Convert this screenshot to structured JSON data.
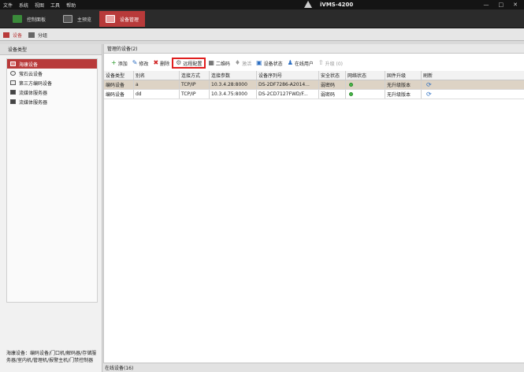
{
  "menu": [
    "文件",
    "系统",
    "视图",
    "工具",
    "帮助"
  ],
  "app_title": "iVMS-4200",
  "window_controls": [
    "—",
    "□",
    "✕"
  ],
  "top_tabs": [
    {
      "label": "控制面板"
    },
    {
      "label": "主预览"
    },
    {
      "label": "设备管理",
      "active": true
    }
  ],
  "sub_tabs": [
    {
      "label": "设备"
    },
    {
      "label": "分组"
    }
  ],
  "left_panel": {
    "header": "设备类型",
    "types": [
      {
        "label": "海康设备",
        "selected": true
      },
      {
        "label": "萤石云设备"
      },
      {
        "label": "第三方编码设备"
      },
      {
        "label": "流媒体服务器"
      },
      {
        "label": "流媒体服务器"
      }
    ],
    "note": "海康设备：编码设备/门口机/解码器/存储服务器/室内机/管理机/报警主机/门禁控制器"
  },
  "right_panel": {
    "header": "管理的设备(2)",
    "toolbar": [
      {
        "icon": "+",
        "label": "添加"
      },
      {
        "icon": "✎",
        "label": "修改"
      },
      {
        "icon": "✖",
        "label": "删除"
      },
      {
        "icon": "⚙",
        "label": "远程配置",
        "highlight": true
      },
      {
        "icon": "▦",
        "label": "二维码"
      },
      {
        "icon": "♦",
        "label": "激活",
        "disabled": true
      },
      {
        "icon": "▣",
        "label": "设备状态"
      },
      {
        "icon": "♟",
        "label": "在线用户"
      },
      {
        "icon": "⇧",
        "label": "升级 (0)",
        "disabled": true
      }
    ],
    "columns": [
      "设备类型",
      "别名",
      "连接方式",
      "连接参数",
      "设备序列号",
      "安全状态",
      "网络状态",
      "固件升级",
      "刷新"
    ],
    "rows": [
      {
        "type": "编码设备",
        "alias": "a",
        "conn": "TCP/IP",
        "param": "10.3.4.28:8000",
        "serial": "DS-2DF7286-A2014...",
        "security": "弱密码",
        "firmware": "无升级版本",
        "selected": true
      },
      {
        "type": "编码设备",
        "alias": "dd",
        "conn": "TCP/IP",
        "param": "10.3.4.75:8000",
        "serial": "DS-2CD7127FWD/F...",
        "security": "弱密码",
        "firmware": "无升级版本",
        "selected": false
      }
    ]
  },
  "bottom_bar": "在线设备(16)",
  "colors": {
    "accent": "#b83a3a",
    "highlight_border": "#e02020",
    "online": "#4bb84b"
  }
}
